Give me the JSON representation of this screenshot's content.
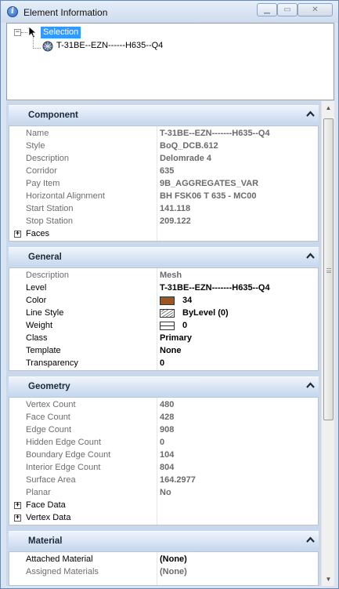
{
  "window": {
    "title": "Element Information"
  },
  "tree": {
    "expander": "−",
    "root_label": "Selection",
    "child_label": "T-31BE--EZN------H635--Q4"
  },
  "sections": {
    "component": {
      "title": "Component",
      "rows": [
        {
          "name": "Name",
          "value": "T-31BE--EZN-------H635--Q4"
        },
        {
          "name": "Style",
          "value": "BoQ_DCB.612"
        },
        {
          "name": "Description",
          "value": "Delomrade 4"
        },
        {
          "name": "Corridor",
          "value": "635"
        },
        {
          "name": "Pay Item",
          "value": "9B_AGGREGATES_VAR"
        },
        {
          "name": "Horizontal Alignment",
          "value": "BH FSK06 T 635 - MC00"
        },
        {
          "name": "Start Station",
          "value": "141.118"
        },
        {
          "name": "Stop Station",
          "value": "209.122"
        },
        {
          "name": "Faces",
          "value": ""
        }
      ]
    },
    "general": {
      "title": "General",
      "rows": [
        {
          "name": "Description",
          "value": "Mesh"
        },
        {
          "name": "Level",
          "value": "T-31BE--EZN-------H635--Q4"
        },
        {
          "name": "Color",
          "value": "34"
        },
        {
          "name": "Line Style",
          "value": "ByLevel (0)"
        },
        {
          "name": "Weight",
          "value": "0"
        },
        {
          "name": "Class",
          "value": "Primary"
        },
        {
          "name": "Template",
          "value": "None"
        },
        {
          "name": "Transparency",
          "value": "0"
        }
      ],
      "color_swatch": "#a0541e"
    },
    "geometry": {
      "title": "Geometry",
      "rows": [
        {
          "name": "Vertex Count",
          "value": "480"
        },
        {
          "name": "Face Count",
          "value": "428"
        },
        {
          "name": "Edge Count",
          "value": "908"
        },
        {
          "name": "Hidden Edge Count",
          "value": "0"
        },
        {
          "name": "Boundary Edge Count",
          "value": "104"
        },
        {
          "name": "Interior Edge Count",
          "value": "804"
        },
        {
          "name": "Surface Area",
          "value": "164.2977"
        },
        {
          "name": "Planar",
          "value": "No"
        },
        {
          "name": "Face Data",
          "value": ""
        },
        {
          "name": "Vertex Data",
          "value": ""
        }
      ]
    },
    "material": {
      "title": "Material",
      "rows": [
        {
          "name": "Attached Material",
          "value": "(None)"
        },
        {
          "name": "Assigned Materials",
          "value": "(None)"
        }
      ]
    }
  }
}
